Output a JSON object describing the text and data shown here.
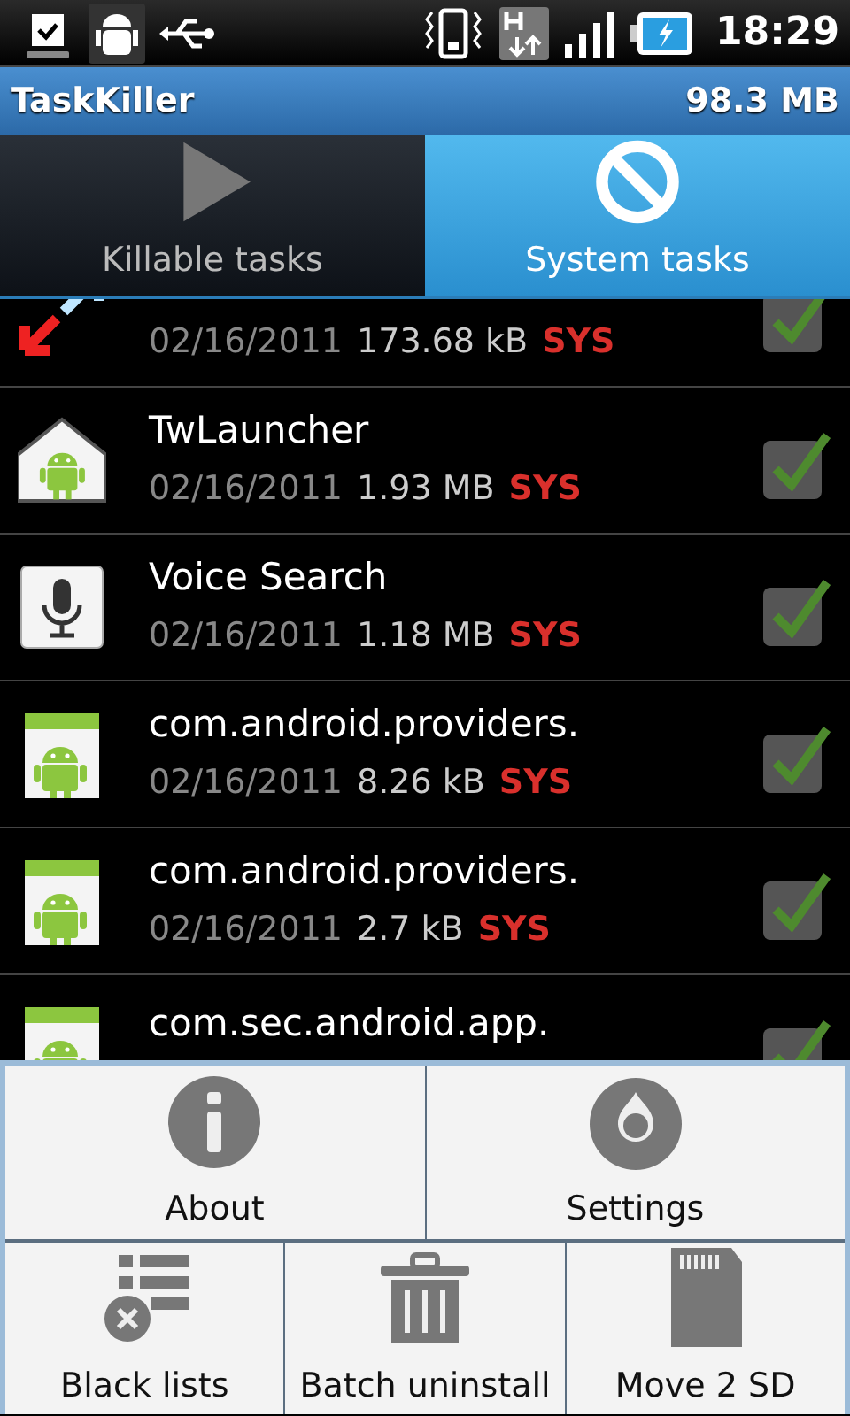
{
  "status_bar": {
    "time": "18:29"
  },
  "title_bar": {
    "title": "TaskKiller",
    "memory": "98.3 MB"
  },
  "tabs": [
    {
      "label": "Killable tasks",
      "selected": false
    },
    {
      "label": "System tasks",
      "selected": true
    }
  ],
  "tasks": [
    {
      "date": "02/16/2011",
      "size": "173.68 kB",
      "tag": "SYS",
      "checked": true
    },
    {
      "name": "TwLauncher",
      "date": "02/16/2011",
      "size": "1.93 MB",
      "tag": "SYS",
      "checked": true
    },
    {
      "name": "Voice Search",
      "date": "02/16/2011",
      "size": "1.18 MB",
      "tag": "SYS",
      "checked": true
    },
    {
      "name": "com.android.providers.",
      "date": "02/16/2011",
      "size": "8.26 kB",
      "tag": "SYS",
      "checked": true
    },
    {
      "name": "com.android.providers.",
      "date": "02/16/2011",
      "size": "2.7 kB",
      "tag": "SYS",
      "checked": true
    },
    {
      "name": "com.sec.android.app.",
      "checked": true
    }
  ],
  "menu": [
    [
      {
        "label": "About"
      },
      {
        "label": "Settings"
      }
    ],
    [
      {
        "label": "Black lists"
      },
      {
        "label": "Batch uninstall"
      },
      {
        "label": "Move 2 SD"
      }
    ]
  ]
}
